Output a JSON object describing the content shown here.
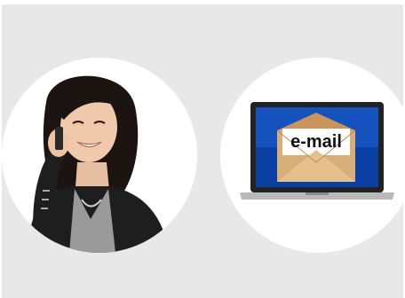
{
  "laptop": {
    "envelope_label": "e-mail"
  },
  "icons": [
    "person-on-phone-photo",
    "laptop-icon",
    "envelope-icon"
  ],
  "colors": {
    "background_panel": "#e8e8e8",
    "circle": "#ffffff",
    "screen_blue": "#0a3fa3",
    "envelope": "#d8ae78",
    "laptop_frame": "#222222",
    "laptop_base": "#b9b9b9"
  }
}
